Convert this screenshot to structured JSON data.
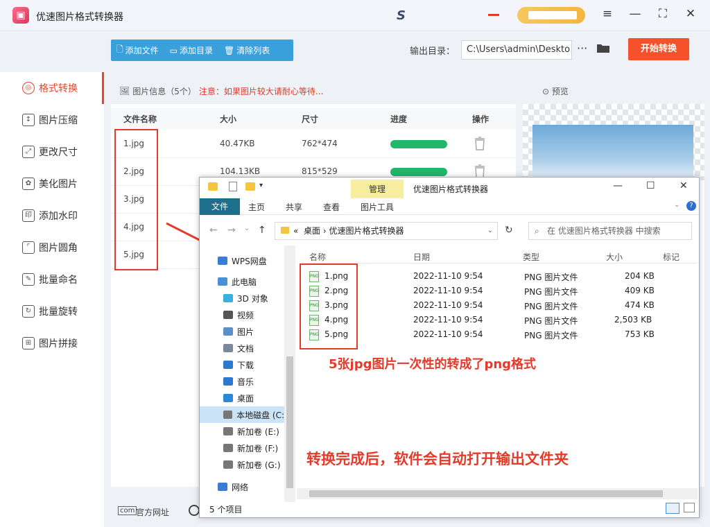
{
  "app": {
    "title": "优速图片格式转换器",
    "logo_glyph": "▣",
    "brand_mark": "S"
  },
  "window_buttons": {
    "menu": "≡",
    "min": "—",
    "max": "⛶",
    "close": "✕"
  },
  "toolbar": {
    "add_file": "添加文件",
    "add_dir": "添加目录",
    "clear_list": "清除列表",
    "output_label": "输出目录：",
    "output_path": "C:\\Users\\admin\\Deskto",
    "more": "···",
    "start": "开始转换"
  },
  "sidebar": {
    "items": [
      {
        "label": "格式转换",
        "icon": "format-icon",
        "active": true
      },
      {
        "label": "图片压缩",
        "icon": "compress-icon"
      },
      {
        "label": "更改尺寸",
        "icon": "resize-icon"
      },
      {
        "label": "美化图片",
        "icon": "beautify-icon"
      },
      {
        "label": "添加水印",
        "icon": "watermark-icon"
      },
      {
        "label": "图片圆角",
        "icon": "round-corner-icon"
      },
      {
        "label": "批量命名",
        "icon": "rename-icon"
      },
      {
        "label": "批量旋转",
        "icon": "rotate-icon"
      },
      {
        "label": "图片拼接",
        "icon": "stitch-icon"
      }
    ]
  },
  "file_list": {
    "info_label": "图片信息（5个）",
    "warning": "注意：如果图片较大请耐心等待...",
    "headers": {
      "name": "文件名称",
      "size": "大小",
      "dim": "尺寸",
      "progress": "进度",
      "action": "操作"
    },
    "rows": [
      {
        "name": "1.jpg",
        "size": "40.47KB",
        "dim": "762*474",
        "progress": 1.0
      },
      {
        "name": "2.jpg",
        "size": "104.13KB",
        "dim": "815*529",
        "progress": 1.0
      },
      {
        "name": "3.jpg",
        "size": "",
        "dim": "",
        "progress": 1.0
      },
      {
        "name": "4.jpg",
        "size": "",
        "dim": "",
        "progress": 1.0
      },
      {
        "name": "5.jpg",
        "size": "",
        "dim": "",
        "progress": 1.0
      }
    ]
  },
  "preview": {
    "label": "预览"
  },
  "footer": {
    "website": "官方网址"
  },
  "explorer": {
    "manage": "管理",
    "title": "优速图片格式转换器",
    "ribbon": {
      "file": "文件",
      "home": "主页",
      "share": "共享",
      "view": "查看",
      "picture_tools": "图片工具"
    },
    "address": {
      "prefix": "«",
      "crumb1": "桌面",
      "sep": "›",
      "crumb2": "优速图片格式转换器"
    },
    "search_placeholder": "在 优速图片格式转换器 中搜索",
    "nav": [
      {
        "label": "WPS网盘",
        "color": "#3a7bd5"
      },
      {
        "label": "此电脑",
        "color": "#4a90d9"
      },
      {
        "label": "3D 对象",
        "color": "#3ab0e0"
      },
      {
        "label": "视频",
        "color": "#555"
      },
      {
        "label": "图片",
        "color": "#5a8fc8"
      },
      {
        "label": "文档",
        "color": "#7a8a9a"
      },
      {
        "label": "下载",
        "color": "#2a7ad0"
      },
      {
        "label": "音乐",
        "color": "#2a7ad0"
      },
      {
        "label": "桌面",
        "color": "#2a8ad8"
      },
      {
        "label": "本地磁盘 (C:",
        "color": "#777"
      },
      {
        "label": "新加卷 (E:)",
        "color": "#777"
      },
      {
        "label": "新加卷 (F:)",
        "color": "#777"
      },
      {
        "label": "新加卷 (G:)",
        "color": "#777"
      },
      {
        "label": "网络",
        "color": "#3a7bd5"
      }
    ],
    "columns": {
      "name": "名称",
      "date": "日期",
      "type": "类型",
      "size": "大小",
      "tag": "标记"
    },
    "files": [
      {
        "name": "1.png",
        "date": "2022-11-10 9:54",
        "type": "PNG 图片文件",
        "size": "204 KB"
      },
      {
        "name": "2.png",
        "date": "2022-11-10 9:54",
        "type": "PNG 图片文件",
        "size": "409 KB"
      },
      {
        "name": "3.png",
        "date": "2022-11-10 9:54",
        "type": "PNG 图片文件",
        "size": "474 KB"
      },
      {
        "name": "4.png",
        "date": "2022-11-10 9:54",
        "type": "PNG 图片文件",
        "size": "2,503 KB"
      },
      {
        "name": "5.png",
        "date": "2022-11-10 9:54",
        "type": "PNG 图片文件",
        "size": "753 KB"
      }
    ],
    "status": "5 个项目",
    "png_badge": "PNG"
  },
  "annotations": {
    "note1": "5张jpg图片一次性的转成了png格式",
    "note2": "转换完成后，软件会自动打开输出文件夹"
  },
  "colors": {
    "accent": "#e9452b",
    "toolbar": "#3aa0dc",
    "progress": "#22b66a",
    "annotation": "#e53a2a"
  }
}
